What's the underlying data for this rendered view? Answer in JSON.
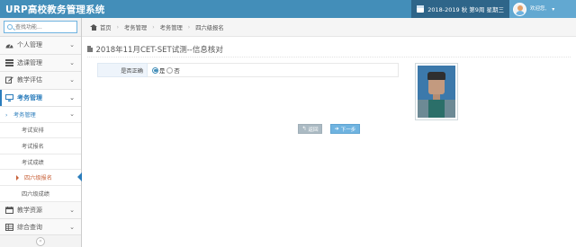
{
  "app": {
    "title": "URP高校教务管理系统"
  },
  "header": {
    "term": "2018-2019 秋 第9周 星期三",
    "user_greeting": "欢迎您,",
    "user_caret": "▾"
  },
  "sidebar": {
    "search_placeholder": "查找功能...",
    "collapse_icon": "«",
    "items": [
      {
        "label": "个人管理",
        "icon": "dashboard-icon",
        "caret": "⌄"
      },
      {
        "label": "选课管理",
        "icon": "list-icon",
        "caret": "⌄"
      },
      {
        "label": "教学评估",
        "icon": "edit-icon",
        "caret": "⌄"
      },
      {
        "label": "考务管理",
        "icon": "desktop-icon",
        "caret": "⌄"
      },
      {
        "label": "教学资源",
        "icon": "calendar-icon",
        "caret": "⌄"
      },
      {
        "label": "综合查询",
        "icon": "table-icon",
        "caret": "⌄"
      }
    ],
    "subnav": {
      "group_label": "考务管理",
      "group_caret": "⌄",
      "items": [
        {
          "label": "考试安排"
        },
        {
          "label": "考试报名"
        },
        {
          "label": "考试成绩"
        },
        {
          "label": "四六级报名"
        },
        {
          "label": "四六级成绩"
        }
      ]
    }
  },
  "breadcrumbs": {
    "items": [
      "首页",
      "考务管理",
      "考务管理",
      "四六级报名"
    ],
    "separator": "›"
  },
  "page": {
    "title": "2018年11月CET-SET试测--信息核对",
    "form": {
      "label": "是否正确",
      "options": [
        {
          "label": "是",
          "checked": true
        },
        {
          "label": "否",
          "checked": false
        }
      ]
    },
    "buttons": {
      "back": "返回",
      "back_icon": "↰",
      "next": "下一步",
      "next_icon": "➜"
    }
  },
  "colors": {
    "navbar": "#438eb9",
    "accent": "#2b7dbc",
    "current": "#c86139",
    "next_button": "#6fb3e0",
    "back_button": "#abbac3"
  }
}
